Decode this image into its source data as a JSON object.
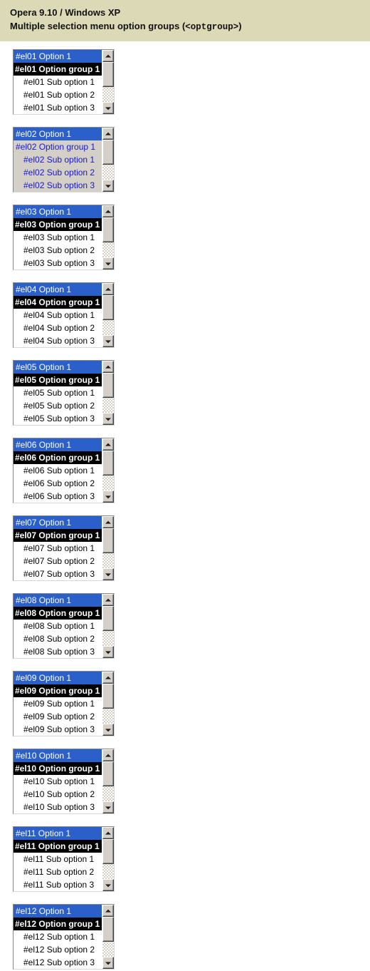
{
  "header": {
    "title_line1": "Opera 9.10 / Windows XP",
    "title_line2_prefix": "Multiple selection menu option groups (",
    "title_line2_code": "<optgroup>",
    "title_line2_suffix": ")"
  },
  "colors": {
    "header_background": "#dcd9b6",
    "page_background": "#ffffff",
    "selection_background": "#2b5fc9",
    "selection_text": "#ffffff",
    "optgroup_background": "#000000",
    "optgroup_text": "#ffffff",
    "variant_background": "#d4d0c8",
    "variant_text": "#1616d4",
    "scrollbar_face": "#d4d0c8"
  },
  "scrollbar": {
    "up_arrow_icon": "triangle-up-icon",
    "down_arrow_icon": "triangle-down-icon",
    "thumb_name": "scrollbar-thumb",
    "track_name": "scrollbar-track"
  },
  "selects": [
    {
      "id": "el01",
      "variant": "normal",
      "options": [
        {
          "label": "#el01 Option 1",
          "type": "option",
          "selected": true
        },
        {
          "label": "#el01 Option group 1",
          "type": "optgroup"
        },
        {
          "label": "#el01 Sub option 1",
          "type": "suboption"
        },
        {
          "label": "#el01 Sub option 2",
          "type": "suboption"
        },
        {
          "label": "#el01 Sub option 3",
          "type": "suboption"
        }
      ]
    },
    {
      "id": "el02",
      "variant": "gray",
      "options": [
        {
          "label": "#el02 Option 1",
          "type": "option",
          "selected": true
        },
        {
          "label": "#el02 Option group 1",
          "type": "optgroup"
        },
        {
          "label": "#el02 Sub option 1",
          "type": "suboption"
        },
        {
          "label": "#el02 Sub option 2",
          "type": "suboption"
        },
        {
          "label": "#el02 Sub option 3",
          "type": "suboption"
        }
      ]
    },
    {
      "id": "el03",
      "variant": "normal",
      "options": [
        {
          "label": "#el03 Option 1",
          "type": "option",
          "selected": true
        },
        {
          "label": "#el03 Option group 1",
          "type": "optgroup"
        },
        {
          "label": "#el03 Sub option 1",
          "type": "suboption"
        },
        {
          "label": "#el03 Sub option 2",
          "type": "suboption"
        },
        {
          "label": "#el03 Sub option 3",
          "type": "suboption"
        }
      ]
    },
    {
      "id": "el04",
      "variant": "normal",
      "options": [
        {
          "label": "#el04 Option 1",
          "type": "option",
          "selected": true
        },
        {
          "label": "#el04 Option group 1",
          "type": "optgroup"
        },
        {
          "label": "#el04 Sub option 1",
          "type": "suboption"
        },
        {
          "label": "#el04 Sub option 2",
          "type": "suboption"
        },
        {
          "label": "#el04 Sub option 3",
          "type": "suboption"
        }
      ]
    },
    {
      "id": "el05",
      "variant": "normal",
      "options": [
        {
          "label": "#el05 Option 1",
          "type": "option",
          "selected": true
        },
        {
          "label": "#el05 Option group 1",
          "type": "optgroup"
        },
        {
          "label": "#el05 Sub option 1",
          "type": "suboption"
        },
        {
          "label": "#el05 Sub option 2",
          "type": "suboption"
        },
        {
          "label": "#el05 Sub option 3",
          "type": "suboption"
        }
      ]
    },
    {
      "id": "el06",
      "variant": "normal",
      "options": [
        {
          "label": "#el06 Option 1",
          "type": "option",
          "selected": true
        },
        {
          "label": "#el06 Option group 1",
          "type": "optgroup"
        },
        {
          "label": "#el06 Sub option 1",
          "type": "suboption"
        },
        {
          "label": "#el06 Sub option 2",
          "type": "suboption"
        },
        {
          "label": "#el06 Sub option 3",
          "type": "suboption"
        }
      ]
    },
    {
      "id": "el07",
      "variant": "normal",
      "options": [
        {
          "label": "#el07 Option 1",
          "type": "option",
          "selected": true
        },
        {
          "label": "#el07 Option group 1",
          "type": "optgroup"
        },
        {
          "label": "#el07 Sub option 1",
          "type": "suboption"
        },
        {
          "label": "#el07 Sub option 2",
          "type": "suboption"
        },
        {
          "label": "#el07 Sub option 3",
          "type": "suboption"
        }
      ]
    },
    {
      "id": "el08",
      "variant": "normal",
      "options": [
        {
          "label": "#el08 Option 1",
          "type": "option",
          "selected": true
        },
        {
          "label": "#el08 Option group 1",
          "type": "optgroup"
        },
        {
          "label": "#el08 Sub option 1",
          "type": "suboption"
        },
        {
          "label": "#el08 Sub option 2",
          "type": "suboption"
        },
        {
          "label": "#el08 Sub option 3",
          "type": "suboption"
        }
      ]
    },
    {
      "id": "el09",
      "variant": "normal",
      "options": [
        {
          "label": "#el09 Option 1",
          "type": "option",
          "selected": true
        },
        {
          "label": "#el09 Option group 1",
          "type": "optgroup"
        },
        {
          "label": "#el09 Sub option 1",
          "type": "suboption"
        },
        {
          "label": "#el09 Sub option 2",
          "type": "suboption"
        },
        {
          "label": "#el09 Sub option 3",
          "type": "suboption"
        }
      ]
    },
    {
      "id": "el10",
      "variant": "normal",
      "options": [
        {
          "label": "#el10 Option 1",
          "type": "option",
          "selected": true
        },
        {
          "label": "#el10 Option group 1",
          "type": "optgroup"
        },
        {
          "label": "#el10 Sub option 1",
          "type": "suboption"
        },
        {
          "label": "#el10 Sub option 2",
          "type": "suboption"
        },
        {
          "label": "#el10 Sub option 3",
          "type": "suboption"
        }
      ]
    },
    {
      "id": "el11",
      "variant": "normal",
      "options": [
        {
          "label": "#el11 Option 1",
          "type": "option",
          "selected": true
        },
        {
          "label": "#el11 Option group 1",
          "type": "optgroup"
        },
        {
          "label": "#el11 Sub option 1",
          "type": "suboption"
        },
        {
          "label": "#el11 Sub option 2",
          "type": "suboption"
        },
        {
          "label": "#el11 Sub option 3",
          "type": "suboption"
        }
      ]
    },
    {
      "id": "el12",
      "variant": "normal",
      "options": [
        {
          "label": "#el12 Option 1",
          "type": "option",
          "selected": true
        },
        {
          "label": "#el12 Option group 1",
          "type": "optgroup"
        },
        {
          "label": "#el12 Sub option 1",
          "type": "suboption"
        },
        {
          "label": "#el12 Sub option 2",
          "type": "suboption"
        },
        {
          "label": "#el12 Sub option 3",
          "type": "suboption"
        }
      ]
    }
  ]
}
